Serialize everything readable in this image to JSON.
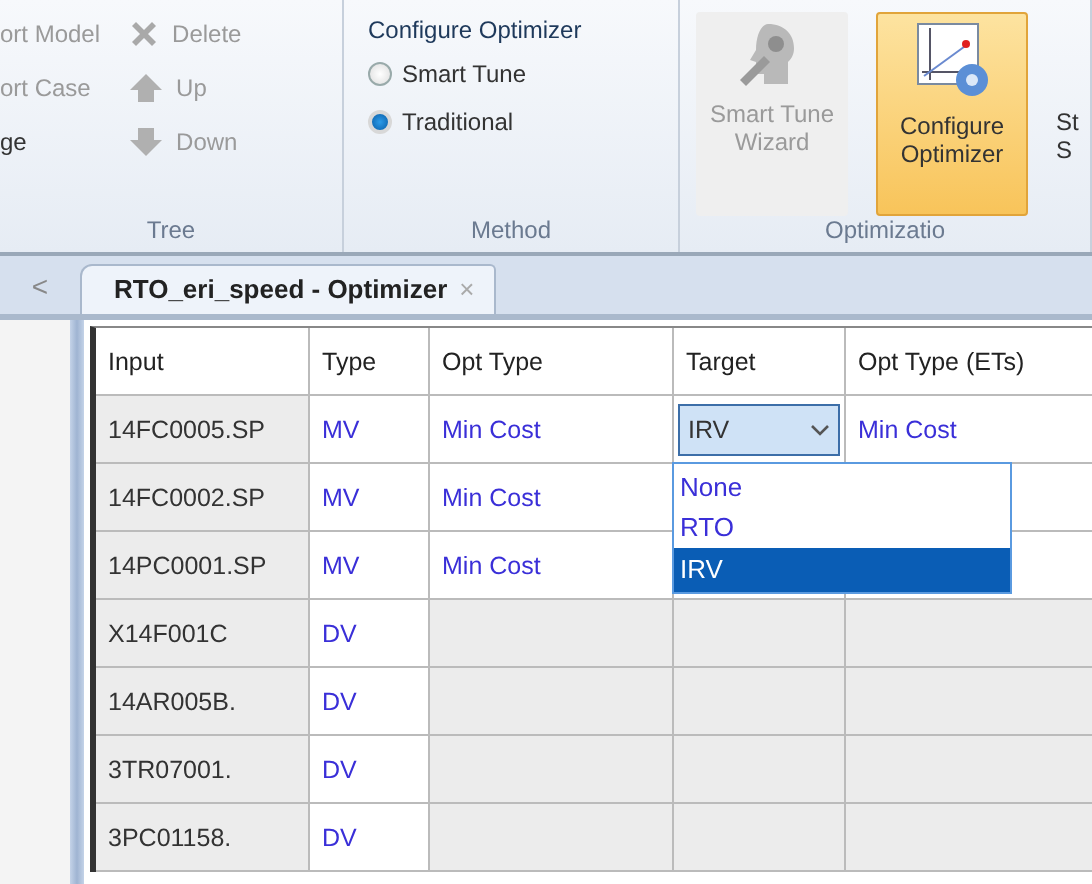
{
  "ribbon": {
    "tree_group": {
      "label": "Tree",
      "items": [
        {
          "text": "ort Model",
          "disabled": true
        },
        {
          "text": "ort Case",
          "disabled": true
        },
        {
          "text": "ge",
          "disabled": false
        }
      ],
      "actions": [
        {
          "kind": "delete",
          "text": "Delete",
          "disabled": true
        },
        {
          "kind": "up",
          "text": "Up",
          "disabled": true
        },
        {
          "kind": "down",
          "text": "Down",
          "disabled": true
        }
      ]
    },
    "method_group": {
      "title": "Configure Optimizer",
      "label": "Method",
      "options": [
        {
          "text": "Smart Tune",
          "selected": false
        },
        {
          "text": "Traditional",
          "selected": true
        }
      ]
    },
    "optimization_group": {
      "label": "Optimizatio",
      "buttons": [
        {
          "kind": "wizard",
          "text": "Smart Tune Wizard",
          "disabled": true,
          "selected": false
        },
        {
          "kind": "configure",
          "text": "Configure Optimizer",
          "disabled": false,
          "selected": true
        }
      ],
      "cut_button": {
        "line_1": "St",
        "line_2": "S"
      }
    }
  },
  "tabs": [
    {
      "label": "RTO_eri_speed - Optimizer",
      "close": "×",
      "selected": true
    }
  ],
  "tab_scroll": "<",
  "table": {
    "columns": [
      "Input",
      "Type",
      "Opt Type",
      "Target",
      "Opt Type (ETs)"
    ],
    "rows": [
      {
        "input": "14FC0005.SP",
        "type": "MV",
        "opt_type": "Min Cost",
        "disabled": false,
        "target": {
          "value": "IRV",
          "open": true,
          "options": [
            {
              "label": "None",
              "selected": false
            },
            {
              "label": "RTO",
              "selected": false
            },
            {
              "label": "IRV",
              "selected": true
            }
          ]
        },
        "opt_type_ets": "Min Cost"
      },
      {
        "input": "14FC0002.SP",
        "type": "MV",
        "opt_type": "Min Cost",
        "disabled": false
      },
      {
        "input": "14PC0001.SP",
        "type": "MV",
        "opt_type": "Min Cost",
        "disabled": false
      },
      {
        "input": "X14F001C",
        "type": "DV",
        "disabled": true
      },
      {
        "input": "14AR005B.",
        "type": "DV",
        "disabled": true
      },
      {
        "input": "3TR07001.",
        "type": "DV",
        "disabled": true
      },
      {
        "input": "3PC01158.",
        "type": "DV",
        "disabled": true
      }
    ]
  }
}
